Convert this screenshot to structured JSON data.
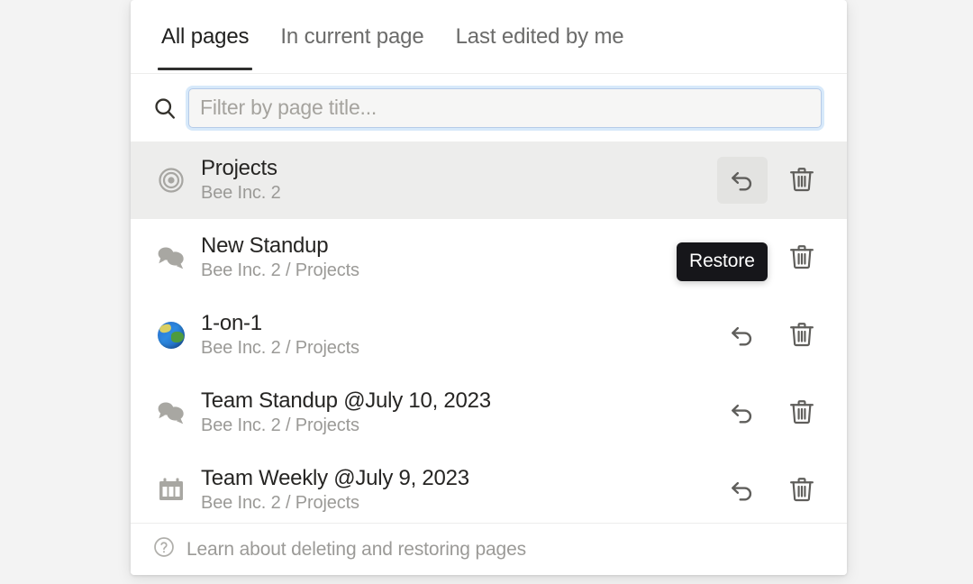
{
  "panel": {
    "tabs": [
      {
        "label": "All pages",
        "active": true
      },
      {
        "label": "In current page",
        "active": false
      },
      {
        "label": "Last edited by me",
        "active": false
      }
    ],
    "search": {
      "icon": "search-icon",
      "value": "",
      "placeholder": "Filter by page title..."
    },
    "rows": [
      {
        "icon": "target-icon",
        "title": "Projects",
        "breadcrumb": "Bee Inc. 2",
        "highlighted": true,
        "restore_hovered": true
      },
      {
        "icon": "speech-balloons-icon",
        "title": "New Standup",
        "breadcrumb": "Bee Inc. 2 / Projects",
        "highlighted": false,
        "restore_hovered": false
      },
      {
        "icon": "globe-icon",
        "title": "1-on-1",
        "breadcrumb": "Bee Inc. 2 / Projects",
        "highlighted": false,
        "restore_hovered": false
      },
      {
        "icon": "speech-balloons-icon",
        "title": "Team Standup @July 10, 2023",
        "breadcrumb": "Bee Inc. 2 / Projects",
        "highlighted": false,
        "restore_hovered": false
      },
      {
        "icon": "calendar-icon",
        "title": "Team Weekly @July 9, 2023",
        "breadcrumb": "Bee Inc. 2 / Projects",
        "highlighted": false,
        "restore_hovered": false
      }
    ],
    "actions": {
      "restore_icon": "undo-arrow-icon",
      "delete_icon": "trash-icon"
    },
    "tooltip": {
      "text": "Restore"
    },
    "footer": {
      "icon": "question-circle-icon",
      "label": "Learn about deleting and restoring pages"
    }
  },
  "colors": {
    "panel_background": "#ffffff",
    "page_background": "#f3f3f3",
    "row_highlight": "#ededec",
    "title_text": "#262523",
    "muted_text": "#9b9a97",
    "tab_underline": "#2f2f2e",
    "focus_ring": "#b6cbe8",
    "tooltip_background": "#16161a"
  }
}
